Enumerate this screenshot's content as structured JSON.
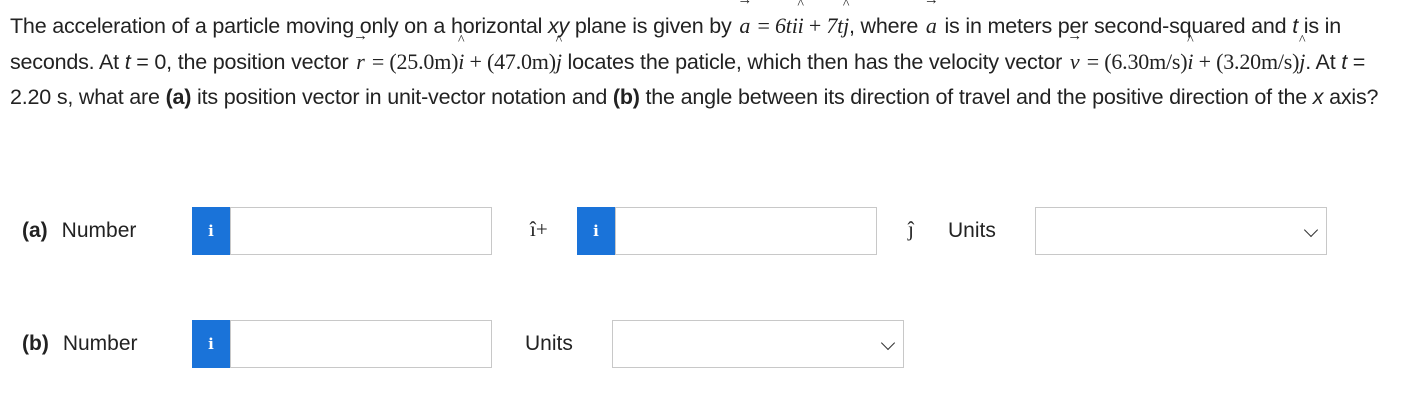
{
  "problem": {
    "t1": "The acceleration of a particle moving only on a horizontal ",
    "xy": "xy",
    "t2": " plane is given by ",
    "a_sym": "a",
    "eq": " = ",
    "a_expr": "6ti",
    "plus": " + ",
    "a_expr2": "7t",
    "j_sym": "j",
    "t3": ", where ",
    "a_sym2": "a",
    "t4": " is in meters per second-squared and ",
    "t_sym": "t",
    "t5": " is in seconds. At ",
    "t_sym2": "t",
    "t6": " = 0, the position vector ",
    "r_sym": "r",
    "eq2": " = ",
    "r_expr": "(25.0m)",
    "i_sym": "i",
    "plus2": " + ",
    "r_expr2": "(47.0m)",
    "j_sym2": "j",
    "t7": " locates the paticle, which then has the velocity vector ",
    "v_sym": "v",
    "eq3": " = ",
    "v_expr": "(6.30m/s)",
    "i_sym2": "i",
    "plus3": " + ",
    "v_expr2": "(3.20m/s)",
    "j_sym3": "j",
    "t8": ". At ",
    "t_sym3": "t",
    "t9": " = 2.20 s, what are ",
    "pa": "(a)",
    "t10": " its position vector in unit-vector notation and ",
    "pb": "(b)",
    "t11": " the angle between its direction of travel and the positive direction of the ",
    "x_sym": "x",
    "t12": " axis?"
  },
  "part_a": {
    "label": "(a)",
    "number_label": "Number",
    "info": "i",
    "i_unit": "î+",
    "j_unit": "ĵ",
    "units_label": "Units",
    "value1": "",
    "value2": "",
    "units_value": ""
  },
  "part_b": {
    "label": "(b)",
    "number_label": "Number",
    "info": "i",
    "units_label": "Units",
    "value": "",
    "units_value": ""
  },
  "colors": {
    "info_button": "#1a73d9",
    "border": "#c8c8c8"
  }
}
